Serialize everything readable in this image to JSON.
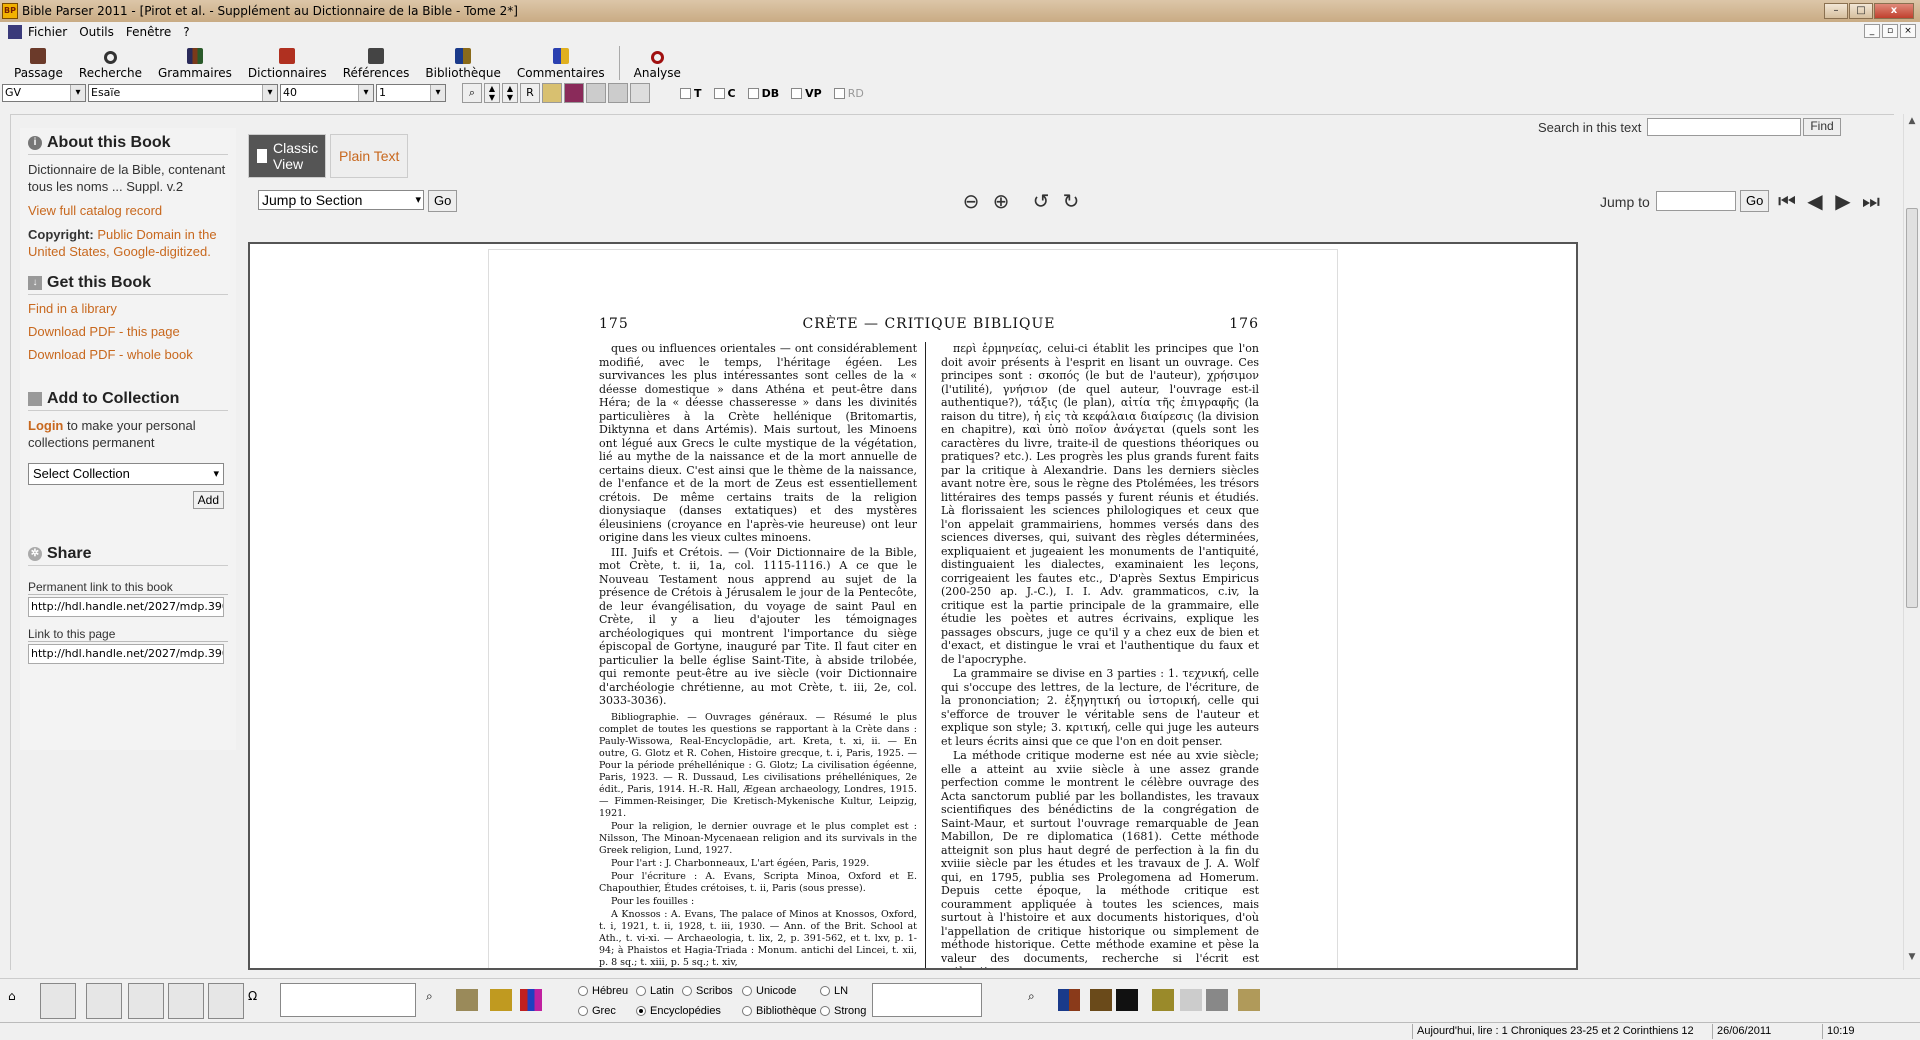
{
  "window": {
    "app_icon": "BP",
    "title": "Bible Parser 2011 - [Pirot et al. - Supplément au Dictionnaire de la Bible - Tome 2*]",
    "buttons": {
      "minimize": "–",
      "maximize": "□",
      "close": "x"
    }
  },
  "menu": {
    "items": [
      "Fichier",
      "Outils",
      "Fenêtre",
      "?"
    ],
    "mdi": [
      "_",
      "▫",
      "×"
    ]
  },
  "toolbar": {
    "items": [
      {
        "label": "Passage",
        "icon": "book-icon"
      },
      {
        "label": "Recherche",
        "icon": "magnifier-icon"
      },
      {
        "label": "Grammaires",
        "icon": "grammar-books-icon"
      },
      {
        "label": "Dictionnaires",
        "icon": "dictionary-icon"
      },
      {
        "label": "Références",
        "icon": "references-icon"
      },
      {
        "label": "Bibliothèque",
        "icon": "library-icon"
      },
      {
        "label": "Commentaires",
        "icon": "commentaries-icon"
      },
      {
        "label": "Analyse",
        "icon": "analysis-icon"
      }
    ]
  },
  "combos": {
    "version": "GV",
    "book": "Esaïe",
    "chapter": "40",
    "verse": "1",
    "r_button": "R"
  },
  "checks": [
    "T",
    "C",
    "DB",
    "VP",
    "RD"
  ],
  "sidebar": {
    "about_title": "About this Book",
    "about_text": "Dictionnaire de la Bible, contenant tous les noms ... Suppl. v.2",
    "catalog_link": "View full catalog record",
    "copyright_label": "Copyright:",
    "copyright_value": "Public Domain in the United States, Google-digitized.",
    "get_title": "Get this Book",
    "find_library": "Find in a library",
    "download_page": "Download PDF - this page",
    "download_whole": "Download PDF - whole book",
    "collection_title": "Add to Collection",
    "login": "Login",
    "login_text": " to make your personal collections permanent",
    "select_collection": "Select Collection",
    "add_button": "Add",
    "share_title": "Share",
    "perm_link_label": "Permanent link to this book",
    "perm_link_value": "http://hdl.handle.net/2027/mdp.390",
    "page_link_label": "Link to this page",
    "page_link_value": "http://hdl.handle.net/2027/mdp.390"
  },
  "viewer": {
    "classic_view": "Classic View",
    "plain_text": "Plain Text",
    "search_label": "Search in this text",
    "find_button": "Find",
    "jump_section": "Jump to Section",
    "go": "Go",
    "jump_to": "Jump to",
    "go2": "Go",
    "icons": [
      "zoom-out-icon",
      "zoom-in-icon",
      "rotate-left-icon",
      "rotate-right-icon",
      "first-page-icon",
      "prev-page-icon",
      "next-page-icon",
      "last-page-icon"
    ]
  },
  "page": {
    "left_num": "175",
    "running_head": "CRÈTE — CRITIQUE BIBLIQUE",
    "right_num": "176",
    "left_col": [
      "ques ou influences orientales — ont considérablement modifié, avec le temps, l'héritage égéen. Les survivances les plus intéressantes sont celles de la « déesse domestique » dans Athéna et peut-être dans Héra; de la « déesse chasseresse » dans les divinités particulières à la Crète hellénique (Britomartis, Diktynna et dans Artémis). Mais surtout, les Minoens ont légué aux Grecs le culte mystique de la végétation, lié au mythe de la naissance et de la mort annuelle de certains dieux. C'est ainsi que le thème de la naissance, de l'enfance et de la mort de Zeus est essentiellement crétois. De même certains traits de la religion dionysiaque (danses extatiques) et des mystères éleusiniens (croyance en l'après-vie heureuse) ont leur origine dans les vieux cultes minoens.",
      "III. Juifs et Crétois. — (Voir Dictionnaire de la Bible, mot Crète, t. ii, 1a, col. 1115-1116.) A ce que le Nouveau Testament nous apprend au sujet de la présence de Crétois à Jérusalem le jour de la Pentecôte, de leur évangélisation, du voyage de saint Paul en Crète, il y a lieu d'ajouter les témoignages archéologiques qui montrent l'importance du siège épiscopal de Gortyne, inauguré par Tite. Il faut citer en particulier la belle église Saint-Tite, à abside trilobée, qui remonte peut-être au ive siècle (voir Dictionnaire d'archéologie chrétienne, au mot Crète, t. iii, 2e, col. 3033-3036)."
    ],
    "left_col_small": [
      "Bibliographie. — Ouvrages généraux. — Résumé le plus complet de toutes les questions se rapportant à la Crète dans : Pauly-Wissowa, Real-Encyclopädie, art. Kreta, t. xi, ii. — En outre, G. Glotz et R. Cohen, Histoire grecque, t. i, Paris, 1925. — Pour la période préhellénique : G. Glotz; La civilisation égéenne, Paris, 1923. — R. Dussaud, Les civilisations préhelléniques, 2e édit., Paris, 1914. H.-R. Hall, Ægean archaeology, Londres, 1915. — Fimmen-Reisinger, Die Kretisch-Mykenische Kultur, Leipzig, 1921.",
      "Pour la religion, le dernier ouvrage et le plus complet est : Nilsson, The Minoan-Mycenaean religion and its survivals in the Greek religion, Lund, 1927.",
      "Pour l'art : J. Charbonneaux, L'art égéen, Paris, 1929.",
      "Pour l'écriture : A. Evans, Scripta Minoa, Oxford et E. Chapouthier, Études crétoises, t. ii, Paris (sous presse).",
      "Pour les fouilles :",
      "A Knossos : A. Evans, The palace of Minos at Knossos, Oxford, t. i, 1921, t. ii, 1928, t. iii, 1930. — Ann. of the Brit. School at Ath., t. vi-xi. — Archaeologia, t. lix, 2, p. 391-562, et t. lxv, p. 1-94; à Phaistos et Hagia-Triada : Monum. antichi del Lincei, t. xii, p. 8 sq.; t. xiii, p. 5 sq.; t. xiv,"
    ],
    "right_col": [
      "περὶ ἑρμηνείας, celui-ci établit les principes que l'on doit avoir présents à l'esprit en lisant un ouvrage. Ces principes sont : σκοπός (le but de l'auteur), χρήσιμον (l'utilité), γνήσιον (de quel auteur, l'ouvrage est-il authentique?), τάξις (le plan), αἰτία τῆς ἐπιγραφῆς (la raison du titre), ἡ εἰς τὰ κεφάλαια διαίρεσις (la division en chapitre), καὶ ὑπὸ ποῖον ἀνάγεται (quels sont les caractères du livre, traite-il de questions théoriques ou pratiques? etc.). Les progrès les plus grands furent faits par la critique à Alexandrie. Dans les derniers siècles avant notre ère, sous le règne des Ptolémées, les trésors littéraires des temps passés y furent réunis et étudiés. Là florissaient les sciences philologiques et ceux que l'on appelait grammairiens, hommes versés dans des sciences diverses, qui, suivant des règles déterminées, expliquaient et jugeaient les monuments de l'antiquité, distinguaient les dialectes, examinaient les leçons, corrigeaient les fautes etc., D'après Sextus Empiricus (200-250 ap. J.-C.), I. I. Adv. grammaticos, c.iv, la critique est la partie principale de la grammaire, elle étudie les poètes et autres écrivains, explique les passages obscurs, juge ce qu'il y a chez eux de bien et d'exact, et distingue le vrai et l'authentique du faux et de l'apocryphe.",
      "La grammaire se divise en 3 parties : 1. τεχνική, celle qui s'occupe des lettres, de la lecture, de l'écriture, de la prononciation; 2. ἐξηγητική ou ἱστορική, celle qui s'efforce de trouver le véritable sens de l'auteur et explique son style; 3. κριτική, celle qui juge les auteurs et leurs écrits ainsi que ce que l'on en doit penser.",
      "La méthode critique moderne est née au xvie siècle; elle a atteint au xviie siècle à une assez grande perfection comme le montrent le célèbre ouvrage des Acta sanctorum publié par les bollandistes, les travaux scientifiques des bénédictins de la congrégation de Saint-Maur, et surtout l'ouvrage remarquable de Jean Mabillon, De re diplomatica (1681). Cette méthode atteignit son plus haut degré de perfection à la fin du xviiie siècle par les études et les travaux de J. A. Wolf qui, en 1795, publia ses Prolegomena ad Homerum. Depuis cette époque, la méthode critique est couramment appliquée à toutes les sciences, mais surtout à l'histoire et aux documents historiques, d'où l'appellation de critique historique ou simplement de méthode historique. Cette méthode examine et pèse la valeur des documents, recherche si l'écrit est authentique"
    ]
  },
  "bottom": {
    "radios": [
      "Hébreu",
      "Latin",
      "Scribos",
      "Unicode",
      "LN",
      "Grec",
      "Encyclopédies",
      "Bibliothèque",
      "Strong"
    ],
    "selected": "Encyclopédies"
  },
  "status": {
    "reading": "Aujourd'hui, lire : 1 Chroniques 23-25 et 2 Corinthiens 12",
    "date": "26/06/2011",
    "time": "10:19"
  }
}
